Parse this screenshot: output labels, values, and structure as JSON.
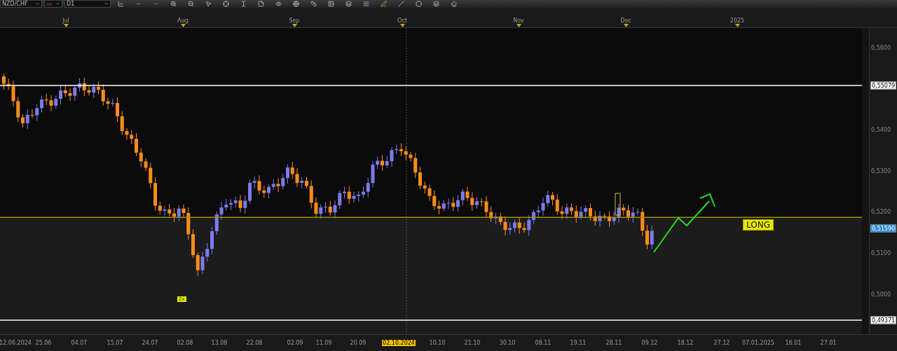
{
  "toolbar": {
    "symbol": "NZD/CHF",
    "timeframe": "D1"
  },
  "month_axis": [
    {
      "label": "Jul"
    },
    {
      "label": "Aug"
    },
    {
      "label": "Sep"
    },
    {
      "label": "Oct"
    },
    {
      "label": "Nov"
    },
    {
      "label": "Dec"
    },
    {
      "label": "2025"
    }
  ],
  "price_axis": {
    "ticks": [
      "0,5600",
      "0,5400",
      "0,5300",
      "0,5200",
      "0,5100",
      "0,5000"
    ],
    "markers": [
      {
        "label": "0,55079",
        "kind": "level"
      },
      {
        "label": "0,51590",
        "kind": "current"
      },
      {
        "label": "0,49371",
        "kind": "level"
      }
    ]
  },
  "date_axis": [
    {
      "label": "12.06.2024",
      "selected": false
    },
    {
      "label": "25.06",
      "selected": false
    },
    {
      "label": "04.07",
      "selected": false
    },
    {
      "label": "15.07",
      "selected": false
    },
    {
      "label": "24.07",
      "selected": false
    },
    {
      "label": "02.08",
      "selected": false
    },
    {
      "label": "13.08",
      "selected": false
    },
    {
      "label": "22.08",
      "selected": false
    },
    {
      "label": "02.09",
      "selected": false
    },
    {
      "label": "11.09",
      "selected": false
    },
    {
      "label": "20.09",
      "selected": false
    },
    {
      "label": "02.10.2024",
      "selected": true
    },
    {
      "label": "10.10",
      "selected": false
    },
    {
      "label": "21.10",
      "selected": false
    },
    {
      "label": "30.10",
      "selected": false
    },
    {
      "label": "08.11",
      "selected": false
    },
    {
      "label": "19.11",
      "selected": false
    },
    {
      "label": "28.11",
      "selected": false
    },
    {
      "label": "09.12",
      "selected": false
    },
    {
      "label": "18.12",
      "selected": false
    },
    {
      "label": "27.12",
      "selected": false
    },
    {
      "label": "07.01.2025",
      "selected": false
    },
    {
      "label": "16.01",
      "selected": false
    },
    {
      "label": "27.01",
      "selected": false
    }
  ],
  "annotations": {
    "signal": "LONG",
    "volume_tag": "2x"
  }
}
